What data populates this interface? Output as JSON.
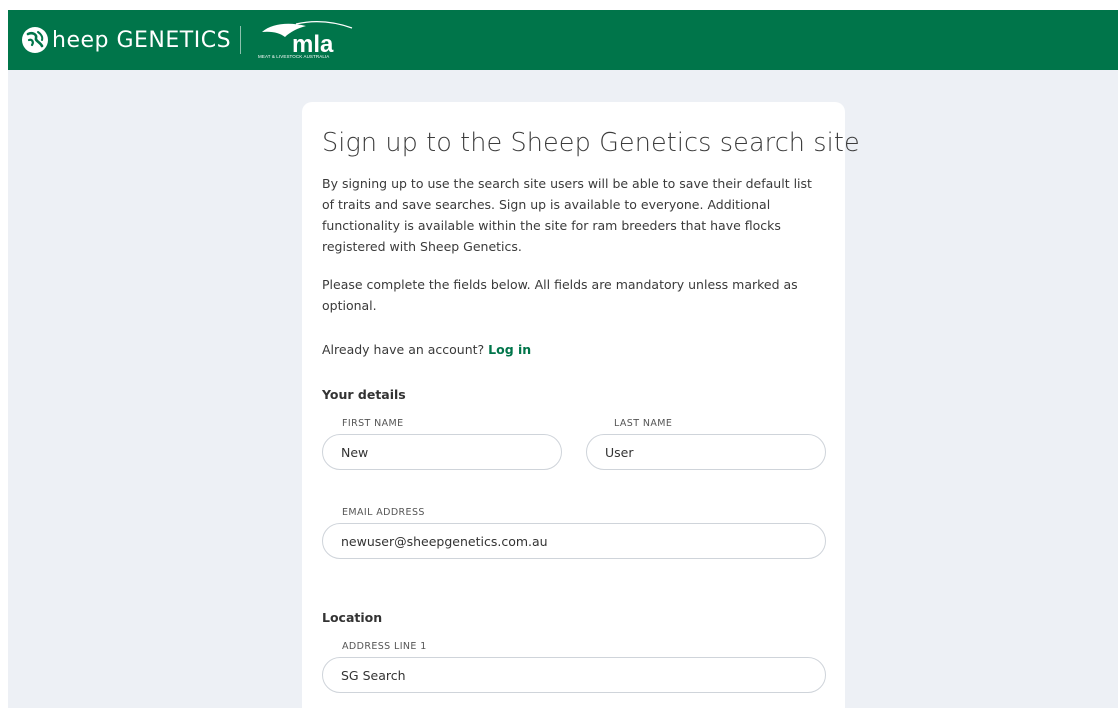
{
  "header": {
    "brand": "heep GENETICS",
    "partner_logo": "mla",
    "partner_sub": "MEAT & LIVESTOCK AUSTRALIA",
    "background": "#00754a"
  },
  "card": {
    "title": "Sign up to the Sheep Genetics search site",
    "intro": "By signing up to use the search site users will be able to save their default list of traits and save searches. Sign up is available to everyone. Additional functionality is available within the site for ram breeders that have flocks registered with Sheep Genetics.",
    "instructions": "Please complete the fields below. All fields are mandatory unless marked as optional.",
    "login_prompt": "Already have an account?",
    "login_link": "Log in",
    "link_color": "#00754a"
  },
  "your_details": {
    "heading": "Your details",
    "first_name": {
      "label": "FIRST NAME",
      "value": "New"
    },
    "last_name": {
      "label": "LAST NAME",
      "value": "User"
    },
    "email": {
      "label": "EMAIL ADDRESS",
      "value": "newuser@sheepgenetics.com.au"
    }
  },
  "location": {
    "heading": "Location",
    "address_line_1": {
      "label": "ADDRESS LINE 1",
      "value": "SG Search"
    }
  }
}
